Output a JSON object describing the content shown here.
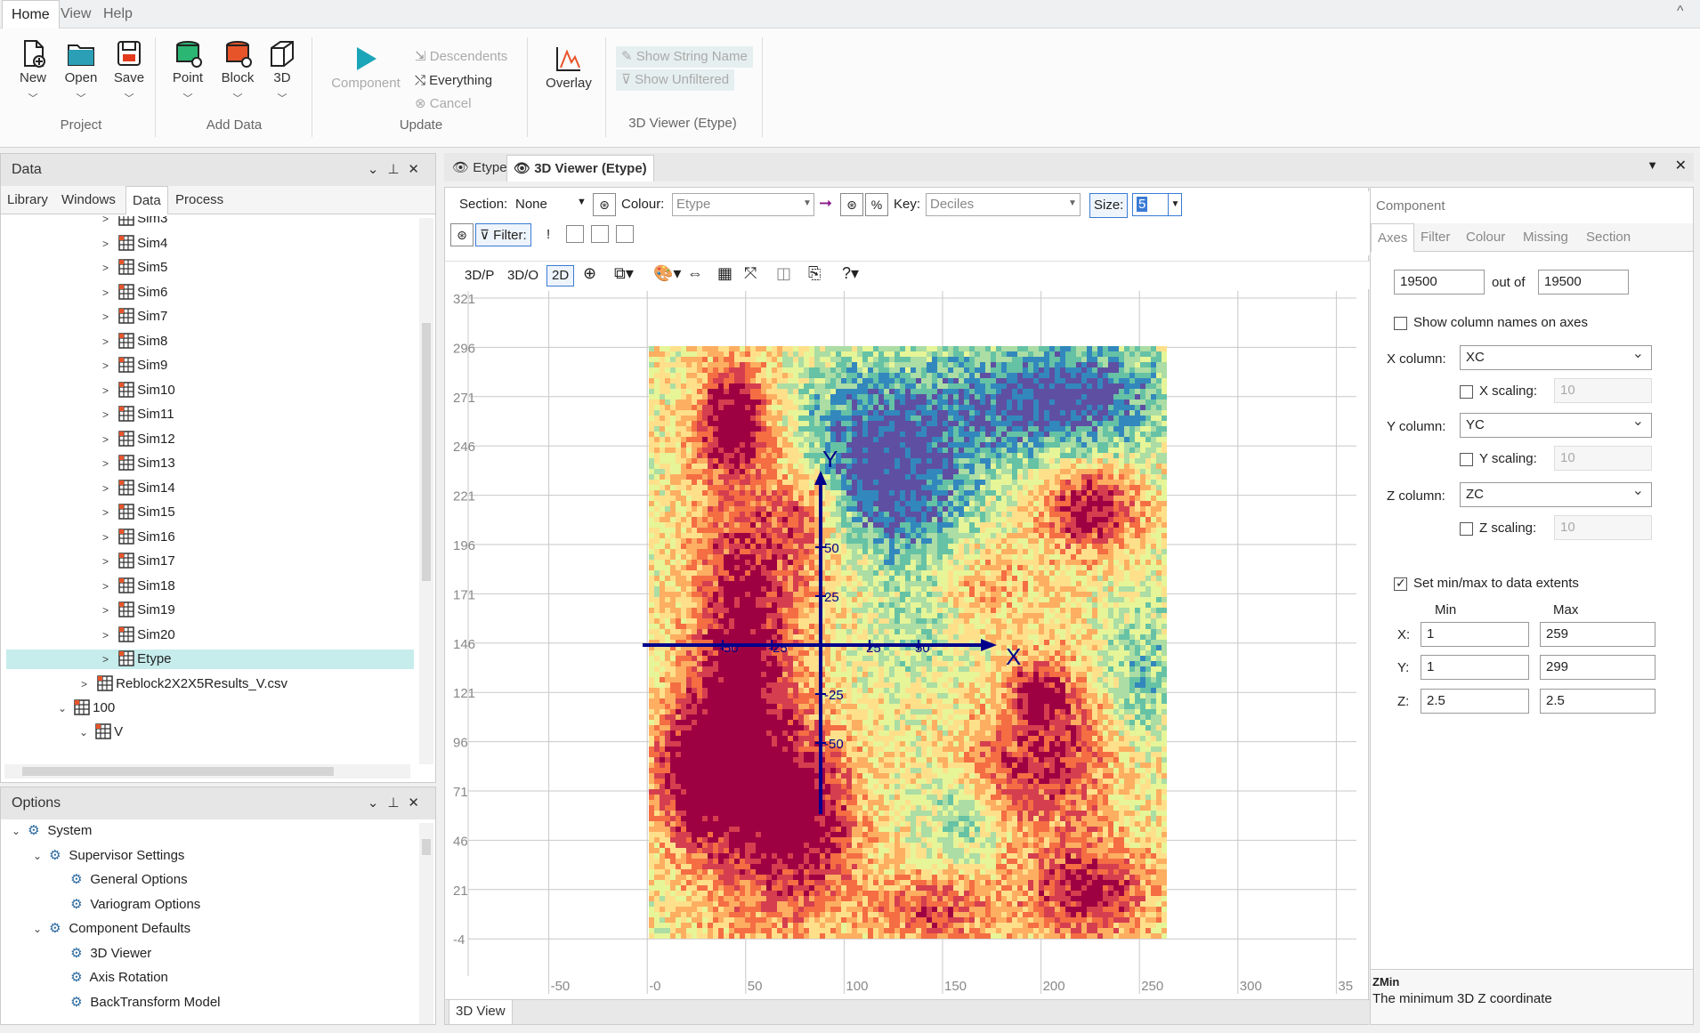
{
  "menu": {
    "items": [
      "Home",
      "View",
      "Help"
    ]
  },
  "window": {
    "collapse_glyph": "^"
  },
  "ribbon": {
    "project": {
      "new": "New",
      "open": "Open",
      "save": "Save",
      "group": "Project"
    },
    "add_data": {
      "point": "Point",
      "block": "Block",
      "three_d": "3D",
      "group": "Add Data"
    },
    "update": {
      "component": "Component",
      "descendents": "Descendents",
      "everything": "Everything",
      "cancel": "Cancel",
      "group": "Update"
    },
    "overlay": "Overlay",
    "viewer_group": {
      "show_string_name": "Show String Name",
      "show_unfiltered": "Show Unfiltered",
      "group": "3D Viewer (Etype)"
    }
  },
  "data_panel": {
    "title": "Data",
    "tabs": [
      "Library",
      "Windows",
      "Data",
      "Process"
    ],
    "active_tab": "Data",
    "tree": [
      {
        "label": "Sim3"
      },
      {
        "label": "Sim4"
      },
      {
        "label": "Sim5"
      },
      {
        "label": "Sim6"
      },
      {
        "label": "Sim7"
      },
      {
        "label": "Sim8"
      },
      {
        "label": "Sim9"
      },
      {
        "label": "Sim10"
      },
      {
        "label": "Sim11"
      },
      {
        "label": "Sim12"
      },
      {
        "label": "Sim13"
      },
      {
        "label": "Sim14"
      },
      {
        "label": "Sim15"
      },
      {
        "label": "Sim16"
      },
      {
        "label": "Sim17"
      },
      {
        "label": "Sim18"
      },
      {
        "label": "Sim19"
      },
      {
        "label": "Sim20"
      },
      {
        "label": "Etype",
        "selected": true
      }
    ],
    "tree_extra": {
      "csv": "Reblock2X2X5Results_V.csv",
      "folder": "100",
      "v": "V"
    }
  },
  "options_panel": {
    "title": "Options",
    "tree": [
      "System",
      "Supervisor Settings",
      "General Options",
      "Variogram Options",
      "Component Defaults",
      "3D Viewer",
      "Axis Rotation",
      "BackTransform Model"
    ]
  },
  "doc_tabs": {
    "etype": "Etype",
    "viewer": "3D Viewer (Etype)",
    "bottom_tab": "3D View"
  },
  "viewer": {
    "section_label": "Section:",
    "section_value": "None",
    "colour_label": "Colour:",
    "colour_value": "Etype",
    "percent": "%",
    "key_label": "Key:",
    "key_value": "Deciles",
    "size_label": "Size:",
    "size_value": "5",
    "filter_label": "Filter:",
    "filter_bang": "!",
    "view_buttons": [
      "3D/P",
      "3D/O",
      "2D"
    ],
    "active_view": "2D"
  },
  "plot": {
    "y_ticks": [
      "321",
      "296",
      "271",
      "246",
      "221",
      "196",
      "171",
      "146",
      "121",
      "96",
      "71",
      "46",
      "21",
      "-4"
    ],
    "x_ticks": [
      "-50",
      "-0",
      "50",
      "100",
      "150",
      "200",
      "250",
      "300",
      "35"
    ],
    "axis_x_label": "X",
    "axis_y_label": "Y",
    "axis_ticks_x": [
      "-50",
      "-25",
      "25",
      "50"
    ],
    "axis_ticks_y": [
      "50",
      "25",
      "-25",
      "-50"
    ]
  },
  "component_panel": {
    "title": "Component",
    "tabs": [
      "Axes",
      "Filter",
      "Colour",
      "Missing",
      "Section"
    ],
    "active_tab": "Axes",
    "count": "19500",
    "out_of_label": "out of",
    "total": "19500",
    "show_col_names": "Show column names on axes",
    "x_column_label": "X column:",
    "x_column": "XC",
    "x_scaling_label": "X scaling:",
    "x_scaling": "10",
    "y_column_label": "Y column:",
    "y_column": "YC",
    "y_scaling_label": "Y scaling:",
    "y_scaling": "10",
    "z_column_label": "Z column:",
    "z_column": "ZC",
    "z_scaling_label": "Z scaling:",
    "z_scaling": "10",
    "set_minmax": "Set min/max to data extents",
    "min_label": "Min",
    "max_label": "Max",
    "x_label": "X:",
    "x_min": "1",
    "x_max": "259",
    "y_label": "Y:",
    "y_min": "1",
    "y_max": "299",
    "z_label": "Z:",
    "z_min": "2.5",
    "z_max": "2.5",
    "help_title": "ZMin",
    "help_text": "The minimum 3D Z coordinate"
  },
  "colors": {
    "accent": "#2b5797",
    "axis": "#00008b",
    "selection": "#c6ecec"
  },
  "heatmap_palette": [
    "#5e4fa2",
    "#3288bd",
    "#66c2a5",
    "#abdda4",
    "#e6f598",
    "#fee08b",
    "#fdae61",
    "#f46d43",
    "#d53e4f",
    "#9e0142"
  ]
}
